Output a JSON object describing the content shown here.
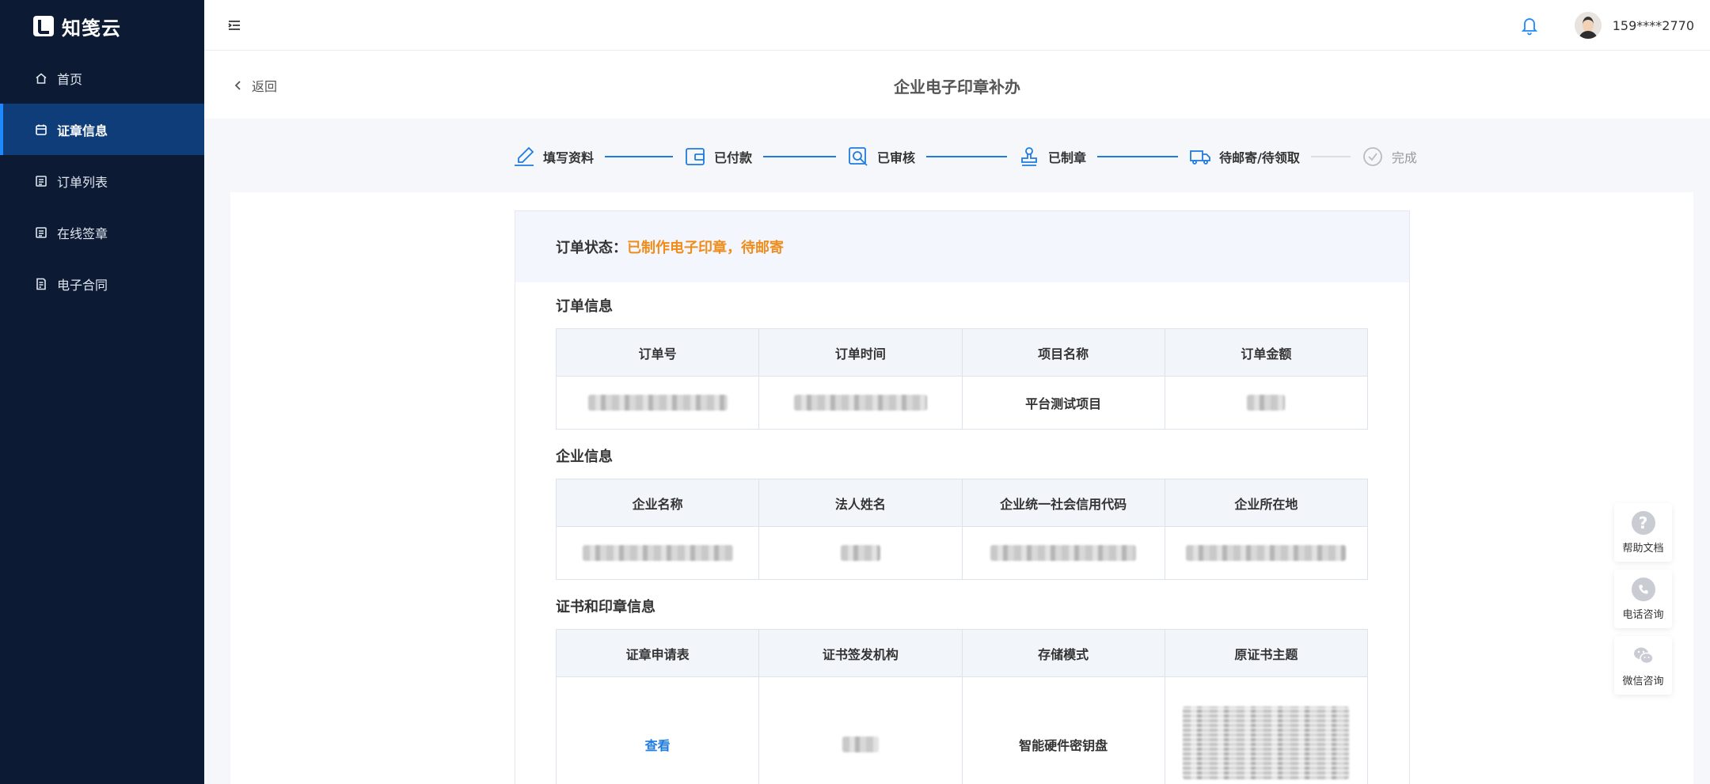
{
  "app": {
    "name": "知笺云"
  },
  "sidebar": {
    "items": [
      {
        "label": "首页",
        "icon": "home-icon"
      },
      {
        "label": "证章信息",
        "icon": "calendar-icon",
        "active": true
      },
      {
        "label": "订单列表",
        "icon": "list-icon"
      },
      {
        "label": "在线签章",
        "icon": "list-icon"
      },
      {
        "label": "电子合同",
        "icon": "document-icon"
      }
    ]
  },
  "header": {
    "username": "159****2770"
  },
  "titlebar": {
    "back_label": "返回",
    "title": "企业电子印章补办"
  },
  "steps": [
    {
      "label": "填写资料",
      "icon": "pen-icon",
      "state": "complete"
    },
    {
      "label": "已付款",
      "icon": "wallet-icon",
      "state": "complete"
    },
    {
      "label": "已审核",
      "icon": "search-doc-icon",
      "state": "complete"
    },
    {
      "label": "已制章",
      "icon": "stamp-icon",
      "state": "complete"
    },
    {
      "label": "待邮寄/待领取",
      "icon": "truck-icon",
      "state": "current"
    },
    {
      "label": "完成",
      "icon": "check-circle-icon",
      "state": "pending"
    }
  ],
  "order_status": {
    "label": "订单状态：",
    "value": "已制作电子印章，待邮寄",
    "color": "#f08c1a"
  },
  "order_info": {
    "title": "订单信息",
    "headers": [
      "订单号",
      "订单时间",
      "项目名称",
      "订单金额"
    ],
    "row": {
      "project_name": "平台测试项目"
    }
  },
  "company_info": {
    "title": "企业信息",
    "headers": [
      "企业名称",
      "法人姓名",
      "企业统一社会信用代码",
      "企业所在地"
    ]
  },
  "cert_info": {
    "title": "证书和印章信息",
    "headers": [
      "证章申请表",
      "证书签发机构",
      "存储模式",
      "原证书主题"
    ],
    "row": {
      "form_link": "查看",
      "storage_mode": "智能硬件密钥盘"
    }
  },
  "float_help": [
    {
      "label": "帮助文档",
      "icon": "question-icon"
    },
    {
      "label": "电话咨询",
      "icon": "phone-icon"
    },
    {
      "label": "微信咨询",
      "icon": "wechat-icon"
    }
  ],
  "colors": {
    "sidebar_bg": "#0c1b33",
    "accent": "#1e7be0",
    "status": "#f08c1a"
  }
}
